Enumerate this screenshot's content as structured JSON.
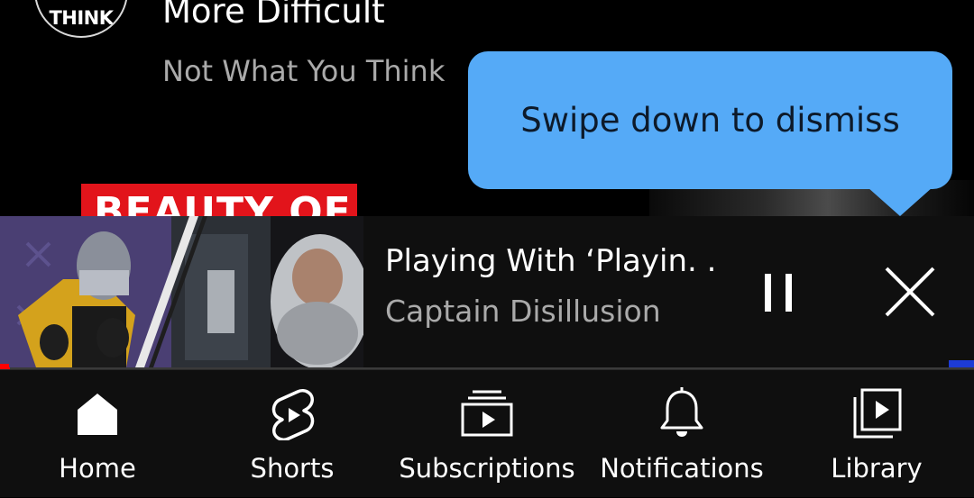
{
  "feed": {
    "avatar_text": "THINK",
    "video_title": "More Difficult",
    "channel_name": "Not What You Think",
    "thumbnail_peek_text": "BEAUTY OF"
  },
  "tooltip": {
    "text": "Swipe down to dismiss"
  },
  "mini_player": {
    "title": "Playing With ‘Playin. .",
    "channel": "Captain Disillusion",
    "progress": 0.01,
    "pause_icon": "pause-icon",
    "close_icon": "close-icon"
  },
  "bottom_nav": {
    "items": [
      {
        "label": "Home",
        "icon": "home-icon"
      },
      {
        "label": "Shorts",
        "icon": "shorts-icon"
      },
      {
        "label": "Subscriptions",
        "icon": "subscriptions-icon"
      },
      {
        "label": "Notifications",
        "icon": "bell-icon"
      },
      {
        "label": "Library",
        "icon": "library-icon"
      }
    ]
  },
  "colors": {
    "background": "#000000",
    "tooltip": "#55aaf7",
    "progress": "#ff0000",
    "secondary_text": "#aaaaaa"
  }
}
